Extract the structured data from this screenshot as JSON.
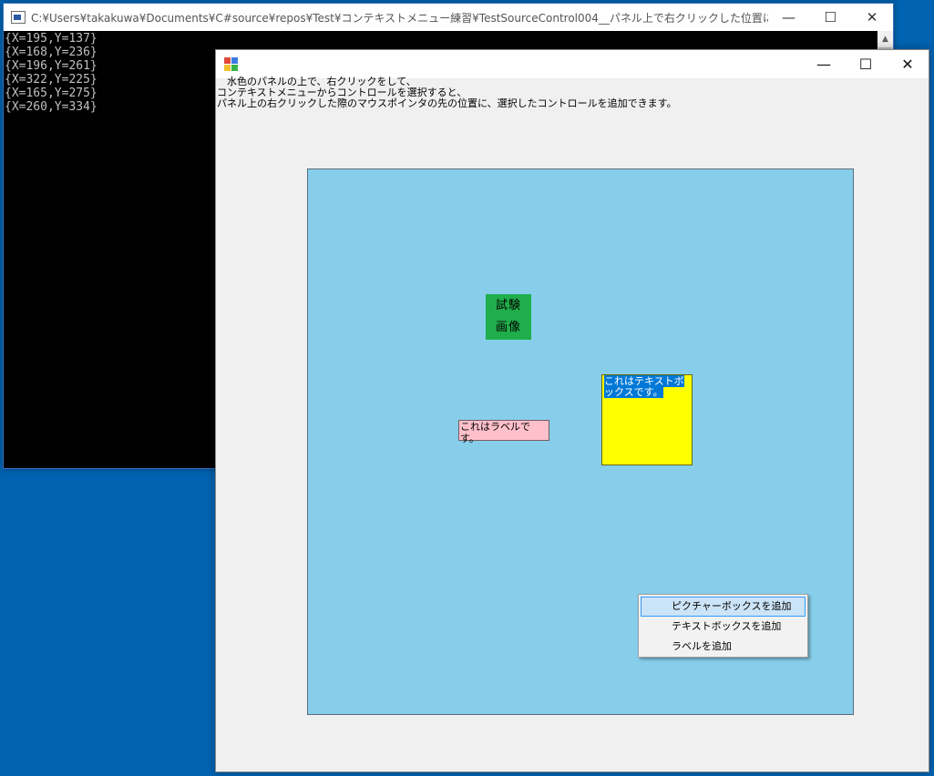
{
  "console": {
    "title": "C:¥Users¥takakuwa¥Documents¥C#source¥repos¥Test¥コンテキストメニュー練習¥TestSourceControl004__パネル上で右クリックした位置にコントロールを追加¥TestSo...",
    "lines": [
      "{X=195,Y=137}",
      "{X=168,Y=236}",
      "{X=196,Y=261}",
      "{X=322,Y=225}",
      "{X=165,Y=275}",
      "{X=260,Y=334}"
    ],
    "minimize": "—",
    "maximize": "☐",
    "close": "✕"
  },
  "form": {
    "minimize": "—",
    "maximize": "☐",
    "close": "✕",
    "instructions": "　水色のパネルの上で、右クリックをして、\nコンテキストメニューからコントロールを選択すると、\nパネル上の右クリックした際のマウスポインタの先の位置に、選択したコントロールを追加できます。",
    "picture_box": {
      "line1": "試験",
      "line2": "画像"
    },
    "text_box": {
      "text": "これはテキストボックスです。"
    },
    "label": {
      "text": "これはラベルです。"
    },
    "context_menu": {
      "items": [
        "ピクチャーボックスを追加",
        "テキストボックスを追加",
        "ラベルを追加"
      ]
    }
  },
  "colors": {
    "panel": "#87ceeb",
    "picture_box": "#1fae4b",
    "text_box": "#ffff00",
    "label": "#ffc0cb",
    "desktop": "#0063b1"
  }
}
